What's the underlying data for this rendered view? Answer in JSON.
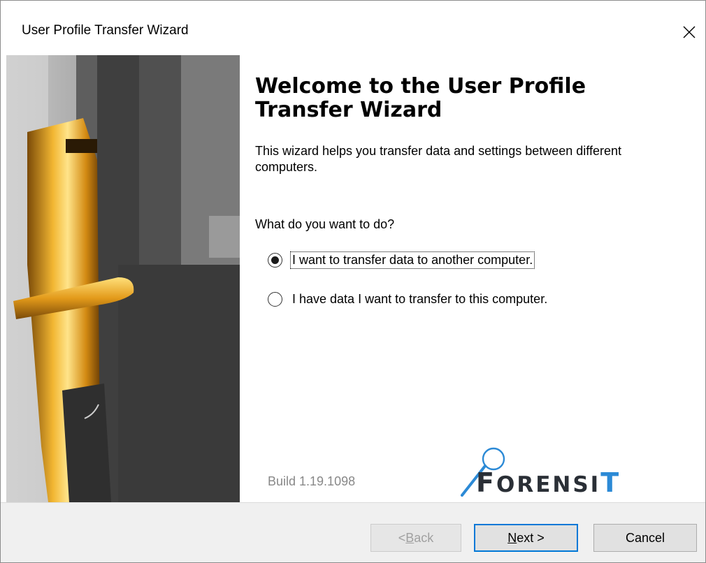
{
  "window": {
    "title": "User Profile Transfer Wizard"
  },
  "icons": {
    "close": "close-icon",
    "logo": "magnifier-logo-icon"
  },
  "main": {
    "heading": "Welcome to the User Profile Transfer Wizard",
    "intro": "This wizard helps you transfer data and settings between different computers.",
    "question": "What do you want to do?",
    "options": [
      {
        "label": "I want to transfer data to another computer.",
        "selected": true
      },
      {
        "label": "I have data I want to transfer to this computer.",
        "selected": false
      }
    ],
    "build": "Build 1.19.1098",
    "logo": "FORENSIT"
  },
  "footer": {
    "back_mnemonic": "B",
    "back_rest": "ack",
    "back_prefix": "< ",
    "next_mnemonic": "N",
    "next_rest": "ext >",
    "cancel": "Cancel"
  },
  "colors": {
    "accent": "#0078d7",
    "logo_accent": "#2c8ad6",
    "logo_dark": "#2a2f36",
    "door_lock_gold": "#e0a020"
  }
}
